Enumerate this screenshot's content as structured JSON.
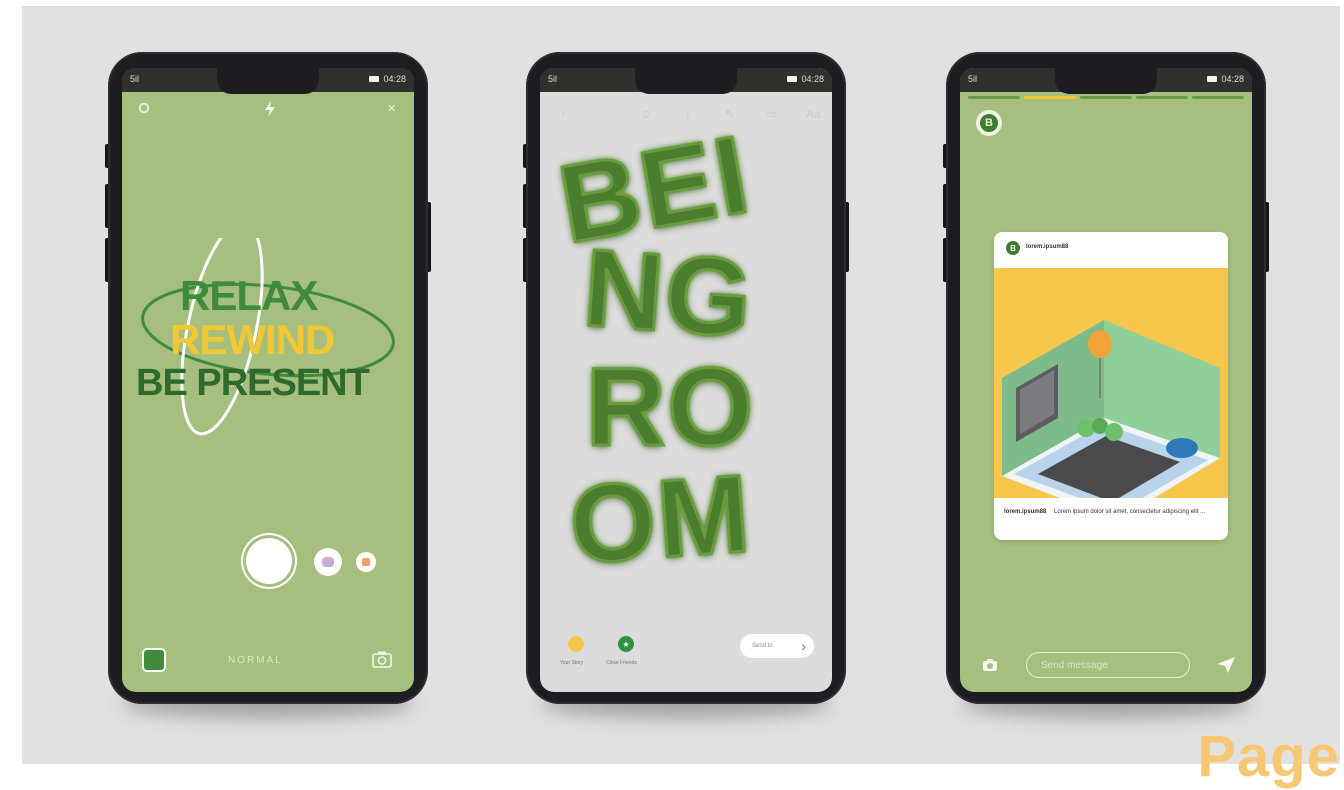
{
  "corner_text": "Page",
  "status": {
    "signal": "5il",
    "time": "04:28"
  },
  "phone1": {
    "art_lines": [
      "RELAX",
      "REWIND",
      "BE PRESENT"
    ],
    "mode_label": "NORMAL",
    "icons": {
      "settings": "settings-icon",
      "flash": "flash-icon",
      "close": "close-icon",
      "flip": "flip-camera-icon"
    },
    "close_glyph": "×"
  },
  "phone2": {
    "art_lines": [
      "BEI",
      "NG",
      "RO",
      "OM"
    ],
    "tool_glyphs": [
      "‹",
      "◌",
      "☺",
      "↓",
      "✎",
      "▭",
      "Aa"
    ],
    "bottom": {
      "story_label": "Your Story",
      "close_friends_label": "Close Friends",
      "send_label": "Send to"
    }
  },
  "phone3": {
    "avatar_letter": "B",
    "post": {
      "username": "lorem.ipsum88",
      "caption_user": "lorem.ipsum88",
      "caption_text": "Lorem ipsum dolor sit amet, consectetur adipiscing elit ..."
    },
    "message_placeholder": "Send message"
  }
}
